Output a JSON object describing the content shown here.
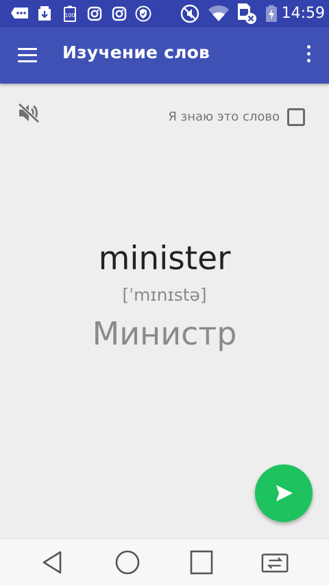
{
  "status_bar": {
    "time": "14:59",
    "icons": [
      "messages-icon",
      "download-icon",
      "battery-100-icon",
      "instagram-icon",
      "instagram-icon",
      "shield-icon",
      "mute-icon",
      "wifi-icon",
      "sim-error-icon",
      "battery-charging-icon"
    ],
    "bg_color": "#3342ac"
  },
  "toolbar": {
    "title": "Изучение слов",
    "bg_color": "#3f51b5"
  },
  "card": {
    "know_label": "Я знаю это слово",
    "know_checked": false,
    "word": "minister",
    "transcription": "[ˈmɪnɪstə]",
    "translation": "Министр"
  },
  "fab": {
    "icon": "play-icon",
    "color": "#1ec25e"
  },
  "nav_bar": {
    "buttons": [
      "back-icon",
      "home-icon",
      "recents-icon",
      "switch-app-icon"
    ]
  }
}
